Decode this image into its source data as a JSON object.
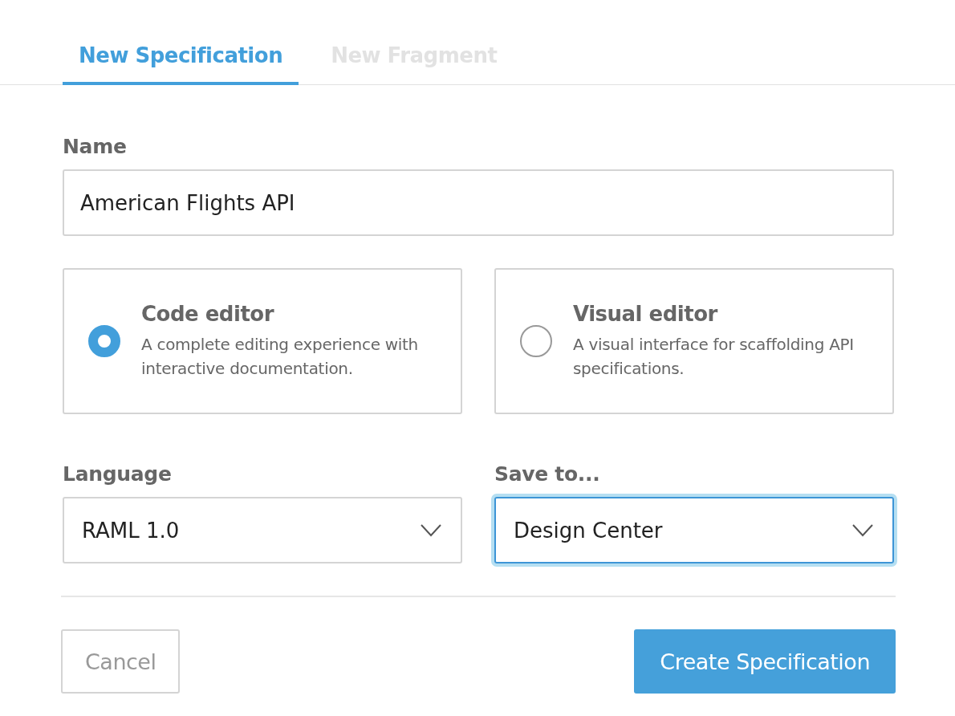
{
  "tabs": [
    {
      "label": "New Specification",
      "selected": true
    },
    {
      "label": "New Fragment",
      "selected": false
    }
  ],
  "name_field": {
    "label": "Name",
    "value": "American Flights API"
  },
  "editor_options": [
    {
      "title": "Code editor",
      "description": "A complete editing experience with interactive documentation.",
      "selected": true
    },
    {
      "title": "Visual editor",
      "description": "A visual interface for scaffolding API specifications.",
      "selected": false
    }
  ],
  "selects": [
    {
      "label": "Language",
      "value": "RAML 1.0",
      "focused": false
    },
    {
      "label": "Save to...",
      "value": "Design Center",
      "focused": true
    }
  ],
  "buttons": {
    "cancel": "Cancel",
    "create": "Create Specification"
  }
}
